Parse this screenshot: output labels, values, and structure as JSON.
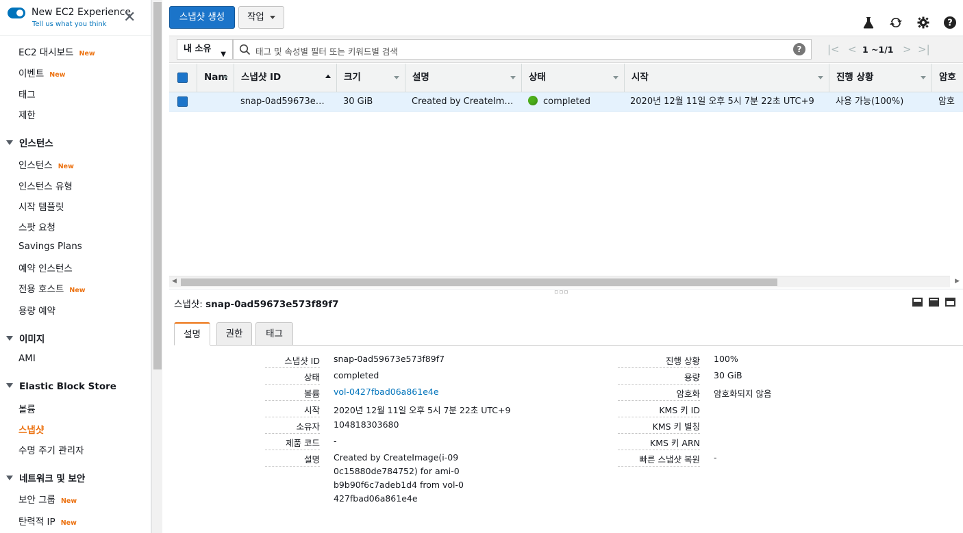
{
  "sidebar": {
    "title": "New EC2 Experience",
    "subtitle": "Tell us what you think",
    "items": [
      {
        "label": "EC2 대시보드",
        "badge": "New"
      },
      {
        "label": "이벤트",
        "badge": "New"
      },
      {
        "label": "태그",
        "badge": ""
      },
      {
        "label": "제한",
        "badge": ""
      }
    ],
    "sections": [
      {
        "title": "인스턴스",
        "items": [
          {
            "label": "인스턴스",
            "badge": "New"
          },
          {
            "label": "인스턴스 유형",
            "badge": ""
          },
          {
            "label": "시작 템플릿",
            "badge": ""
          },
          {
            "label": "스팟 요청",
            "badge": ""
          },
          {
            "label": "Savings Plans",
            "badge": ""
          },
          {
            "label": "예약 인스턴스",
            "badge": ""
          },
          {
            "label": "전용 호스트",
            "badge": "New"
          },
          {
            "label": "용량 예약",
            "badge": ""
          }
        ]
      },
      {
        "title": "이미지",
        "items": [
          {
            "label": "AMI",
            "badge": ""
          }
        ]
      },
      {
        "title": "Elastic Block Store",
        "items": [
          {
            "label": "볼륨",
            "badge": ""
          },
          {
            "label": "스냅샷",
            "badge": ""
          },
          {
            "label": "수명 주기 관리자",
            "badge": ""
          }
        ]
      },
      {
        "title": "네트워크 및 보안",
        "items": [
          {
            "label": "보안 그룹",
            "badge": "New"
          },
          {
            "label": "탄력적 IP",
            "badge": "New"
          }
        ]
      }
    ],
    "active_item": "스냅샷"
  },
  "toolbar": {
    "create_label": "스냅샷 생성",
    "actions_label": "작업",
    "icons": [
      "flask-icon",
      "refresh-icon",
      "gear-icon",
      "help-icon"
    ]
  },
  "filter": {
    "owner_label": "내 소유",
    "search_placeholder": "태그 및 속성별 필터 또는 키워드별 검색",
    "pagination": "1 ~1/1"
  },
  "table": {
    "columns": [
      "Nam",
      "스냅샷 ID",
      "크기",
      "설명",
      "상태",
      "시작",
      "진행 상황",
      "암호"
    ],
    "rows": [
      {
        "name": "",
        "snapshot_id": "snap-0ad59673e573f89f7",
        "size": "30 GiB",
        "description": "Created by CreateImage(i-090c15880de784752) for ami-0b9b90f6c7adeb1d4 from vol-0427fbad06a861e4e",
        "status": "completed",
        "started": "2020년 12월 11일 오후 5시 7분 22초 UTC+9",
        "progress": "사용 가능(100%)",
        "encryption": "암호"
      }
    ]
  },
  "detail": {
    "title_prefix": "스냅샷:",
    "title_id": "snap-0ad59673e573f89f7",
    "tabs": [
      "설명",
      "권한",
      "태그"
    ],
    "active_tab": "설명",
    "left": [
      {
        "label": "스냅샷 ID",
        "value": "snap-0ad59673e573f89f7"
      },
      {
        "label": "상태",
        "value": "completed"
      },
      {
        "label": "볼륨",
        "value": "vol-0427fbad06a861e4e"
      },
      {
        "label": "시작",
        "value": "2020년 12월 11일 오후 5시 7분 22초 UTC+9"
      },
      {
        "label": "소유자",
        "value": "104818303680"
      },
      {
        "label": "제품 코드",
        "value": "-"
      },
      {
        "label": "설명",
        "value": "Created by CreateImage(i-090c15880de784752) for ami-0b9b90f6c7adeb1d4 from vol-0427fbad06a861e4e"
      }
    ],
    "right": [
      {
        "label": "진행 상황",
        "value": "100%"
      },
      {
        "label": "용량",
        "value": "30 GiB"
      },
      {
        "label": "암호화",
        "value": "암호화되지 않음"
      },
      {
        "label": "KMS 키 ID",
        "value": ""
      },
      {
        "label": "KMS 키 별칭",
        "value": ""
      },
      {
        "label": "KMS 키 ARN",
        "value": ""
      },
      {
        "label": "빠른 스냅샷 복원",
        "value": "-"
      }
    ]
  },
  "colors": {
    "primary": "#1b74c9",
    "accent": "#ec7211",
    "link": "#0073bb",
    "status_ok": "#4caf1a"
  }
}
